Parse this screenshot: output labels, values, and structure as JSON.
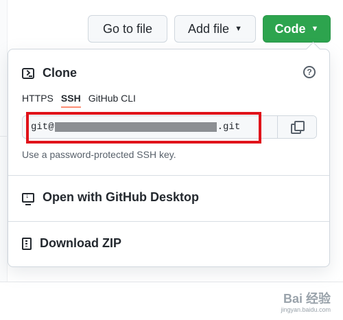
{
  "toolbar": {
    "go_to_file": "Go to file",
    "add_file": "Add file",
    "code": "Code"
  },
  "clone": {
    "title": "Clone",
    "tabs": [
      {
        "label": "HTTPS",
        "active": false
      },
      {
        "label": "SSH",
        "active": true
      },
      {
        "label": "GitHub CLI",
        "active": false
      }
    ],
    "url_prefix": "git@",
    "url_suffix": ".git",
    "hint": "Use a password-protected SSH key."
  },
  "actions": {
    "open_desktop": "Open with GitHub Desktop",
    "download_zip": "Download ZIP"
  },
  "watermark": {
    "brand": "Bai 经验",
    "url": "jingyan.baidu.com"
  },
  "colors": {
    "primary": "#2da44e",
    "highlight": "#e0131a",
    "tab_underline": "#fd8c73"
  }
}
